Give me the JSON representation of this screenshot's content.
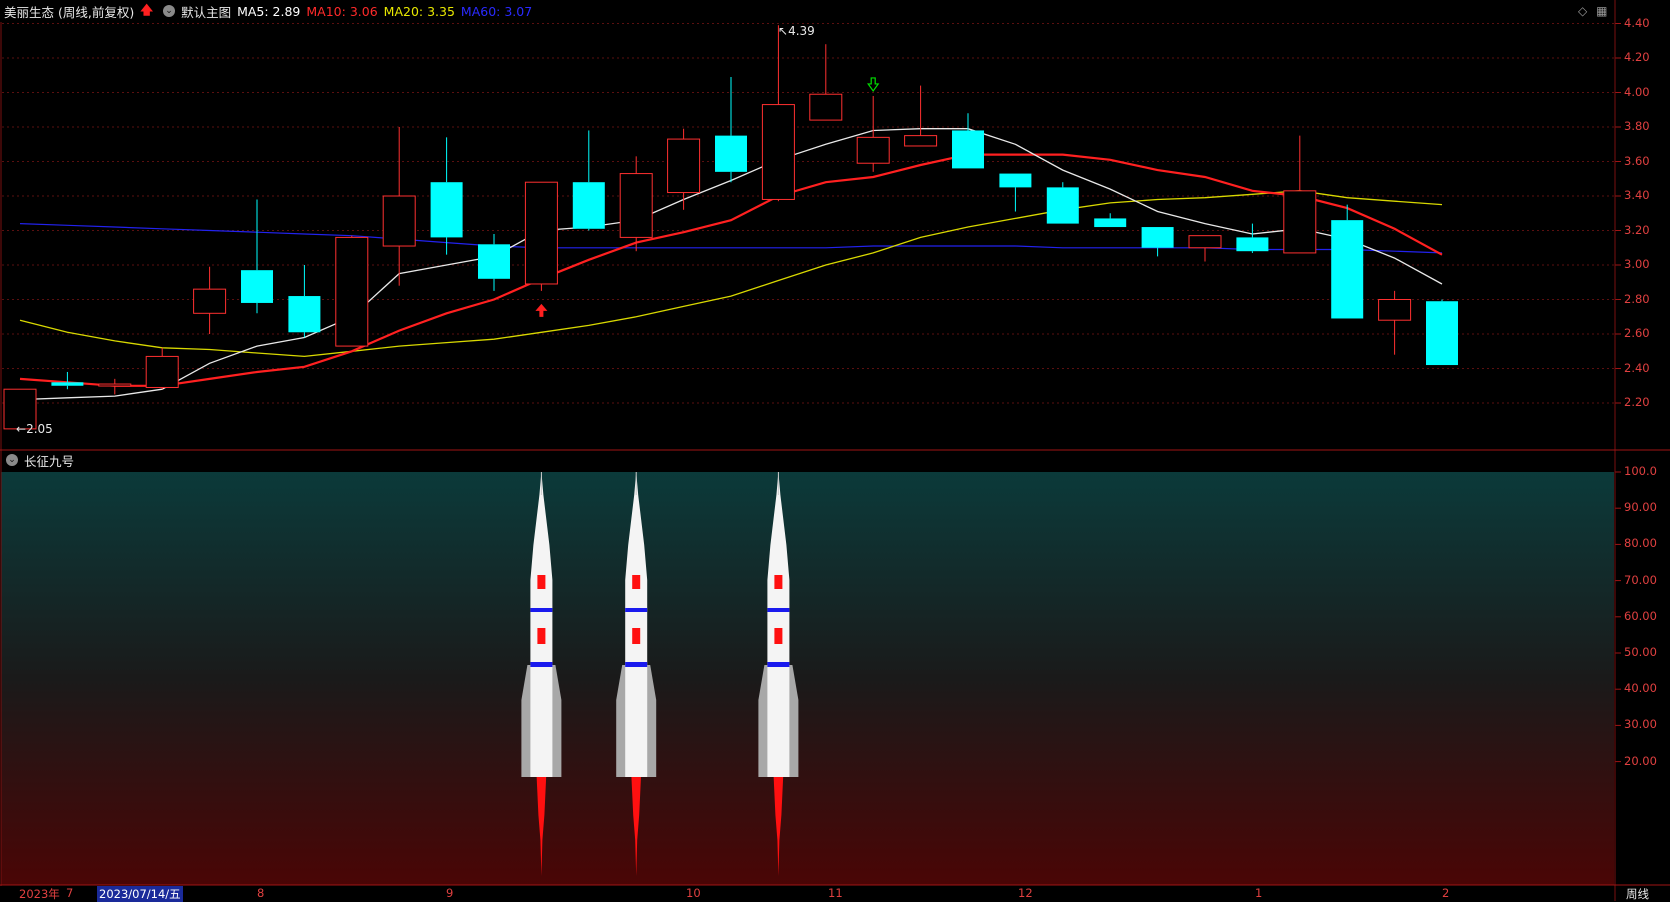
{
  "header": {
    "stock_title": "美丽生态 (周线,前复权)",
    "main_chart_label": "默认主图",
    "ma": [
      {
        "label": "MA5: 2.89",
        "color": "#ffffff"
      },
      {
        "label": "MA10: 3.06",
        "color": "#ff2a2a"
      },
      {
        "label": "MA20: 3.35",
        "color": "#e8e800"
      },
      {
        "label": "MA60: 3.07",
        "color": "#2a2aff"
      }
    ]
  },
  "indicator_panel": {
    "title": "长征九号",
    "y_ticks": [
      "100.0",
      "90.00",
      "80.00",
      "70.00",
      "60.00",
      "50.00",
      "40.00",
      "30.00",
      "20.00"
    ]
  },
  "timeline": {
    "year_label": "2023年",
    "month_labels": [
      "7",
      "8",
      "9",
      "10",
      "11",
      "12",
      "1",
      "2"
    ],
    "cursor_date": "2023/07/14/五",
    "period_label": "周线"
  },
  "colors": {
    "up": "#ff3030",
    "down": "#00ffff",
    "grid": "#5a1010",
    "axis_text": "#e04040"
  },
  "chart_data": {
    "type": "candlestick",
    "ylim": [
      2.0,
      4.45
    ],
    "y_ticks": [
      "4.40",
      "4.20",
      "4.00",
      "3.80",
      "3.60",
      "3.40",
      "3.20",
      "3.00",
      "2.80",
      "2.60",
      "2.40",
      "2.20"
    ],
    "max_label": "4.39",
    "min_label": "2.05",
    "candles": [
      {
        "o": 2.05,
        "h": 2.28,
        "l": 2.05,
        "c": 2.28
      },
      {
        "o": 2.32,
        "h": 2.38,
        "l": 2.28,
        "c": 2.3
      },
      {
        "o": 2.3,
        "h": 2.34,
        "l": 2.25,
        "c": 2.31
      },
      {
        "o": 2.29,
        "h": 2.52,
        "l": 2.28,
        "c": 2.47
      },
      {
        "o": 2.72,
        "h": 2.99,
        "l": 2.6,
        "c": 2.86
      },
      {
        "o": 2.97,
        "h": 3.38,
        "l": 2.72,
        "c": 2.78
      },
      {
        "o": 2.82,
        "h": 3.0,
        "l": 2.58,
        "c": 2.61
      },
      {
        "o": 2.53,
        "h": 3.17,
        "l": 2.53,
        "c": 3.16
      },
      {
        "o": 3.11,
        "h": 3.8,
        "l": 2.88,
        "c": 3.4
      },
      {
        "o": 3.48,
        "h": 3.74,
        "l": 3.06,
        "c": 3.16
      },
      {
        "o": 3.12,
        "h": 3.18,
        "l": 2.85,
        "c": 2.92
      },
      {
        "o": 2.89,
        "h": 3.48,
        "l": 2.85,
        "c": 3.48
      },
      {
        "o": 3.48,
        "h": 3.78,
        "l": 3.2,
        "c": 3.21
      },
      {
        "o": 3.16,
        "h": 3.63,
        "l": 3.08,
        "c": 3.53
      },
      {
        "o": 3.42,
        "h": 3.79,
        "l": 3.32,
        "c": 3.73
      },
      {
        "o": 3.75,
        "h": 4.09,
        "l": 3.48,
        "c": 3.54
      },
      {
        "o": 3.38,
        "h": 4.39,
        "l": 3.37,
        "c": 3.93
      },
      {
        "o": 3.84,
        "h": 4.28,
        "l": 3.84,
        "c": 3.99
      },
      {
        "o": 3.59,
        "h": 3.98,
        "l": 3.54,
        "c": 3.74
      },
      {
        "o": 3.69,
        "h": 4.04,
        "l": 3.69,
        "c": 3.75
      },
      {
        "o": 3.78,
        "h": 3.88,
        "l": 3.56,
        "c": 3.56
      },
      {
        "o": 3.53,
        "h": 3.53,
        "l": 3.31,
        "c": 3.45
      },
      {
        "o": 3.45,
        "h": 3.48,
        "l": 3.24,
        "c": 3.24
      },
      {
        "o": 3.27,
        "h": 3.3,
        "l": 3.22,
        "c": 3.22
      },
      {
        "o": 3.22,
        "h": 3.22,
        "l": 3.05,
        "c": 3.1
      },
      {
        "o": 3.1,
        "h": 3.17,
        "l": 3.02,
        "c": 3.17
      },
      {
        "o": 3.16,
        "h": 3.24,
        "l": 3.07,
        "c": 3.08
      },
      {
        "o": 3.07,
        "h": 3.75,
        "l": 3.07,
        "c": 3.43
      },
      {
        "o": 3.26,
        "h": 3.35,
        "l": 2.69,
        "c": 2.69
      },
      {
        "o": 2.68,
        "h": 2.85,
        "l": 2.48,
        "c": 2.8
      },
      {
        "o": 2.79,
        "h": 2.8,
        "l": 2.42,
        "c": 2.42
      }
    ],
    "ma5": [
      2.22,
      2.23,
      2.24,
      2.28,
      2.43,
      2.53,
      2.58,
      2.7,
      2.95,
      3.0,
      3.05,
      3.2,
      3.22,
      3.26,
      3.38,
      3.49,
      3.61,
      3.7,
      3.78,
      3.79,
      3.79,
      3.7,
      3.55,
      3.44,
      3.31,
      3.24,
      3.18,
      3.21,
      3.15,
      3.04,
      2.89
    ],
    "ma10": [
      2.34,
      2.32,
      2.3,
      2.3,
      2.34,
      2.38,
      2.41,
      2.5,
      2.62,
      2.72,
      2.8,
      2.92,
      3.03,
      3.13,
      3.19,
      3.26,
      3.4,
      3.48,
      3.51,
      3.58,
      3.64,
      3.64,
      3.64,
      3.61,
      3.55,
      3.51,
      3.43,
      3.4,
      3.33,
      3.21,
      3.06
    ],
    "ma20": [
      2.68,
      2.61,
      2.56,
      2.52,
      2.51,
      2.49,
      2.47,
      2.5,
      2.53,
      2.55,
      2.57,
      2.61,
      2.65,
      2.7,
      2.76,
      2.82,
      2.91,
      3.0,
      3.07,
      3.16,
      3.22,
      3.27,
      3.32,
      3.36,
      3.38,
      3.39,
      3.41,
      3.43,
      3.39,
      3.37,
      3.35
    ],
    "ma60": [
      3.24,
      3.23,
      3.22,
      3.21,
      3.2,
      3.19,
      3.18,
      3.17,
      3.15,
      3.13,
      3.11,
      3.1,
      3.1,
      3.1,
      3.1,
      3.1,
      3.1,
      3.1,
      3.11,
      3.11,
      3.11,
      3.11,
      3.1,
      3.1,
      3.1,
      3.1,
      3.09,
      3.09,
      3.09,
      3.08,
      3.07
    ],
    "buy_signal_index": 11,
    "sell_signal_index": 18,
    "rocket_indices": [
      11,
      13,
      16
    ]
  }
}
